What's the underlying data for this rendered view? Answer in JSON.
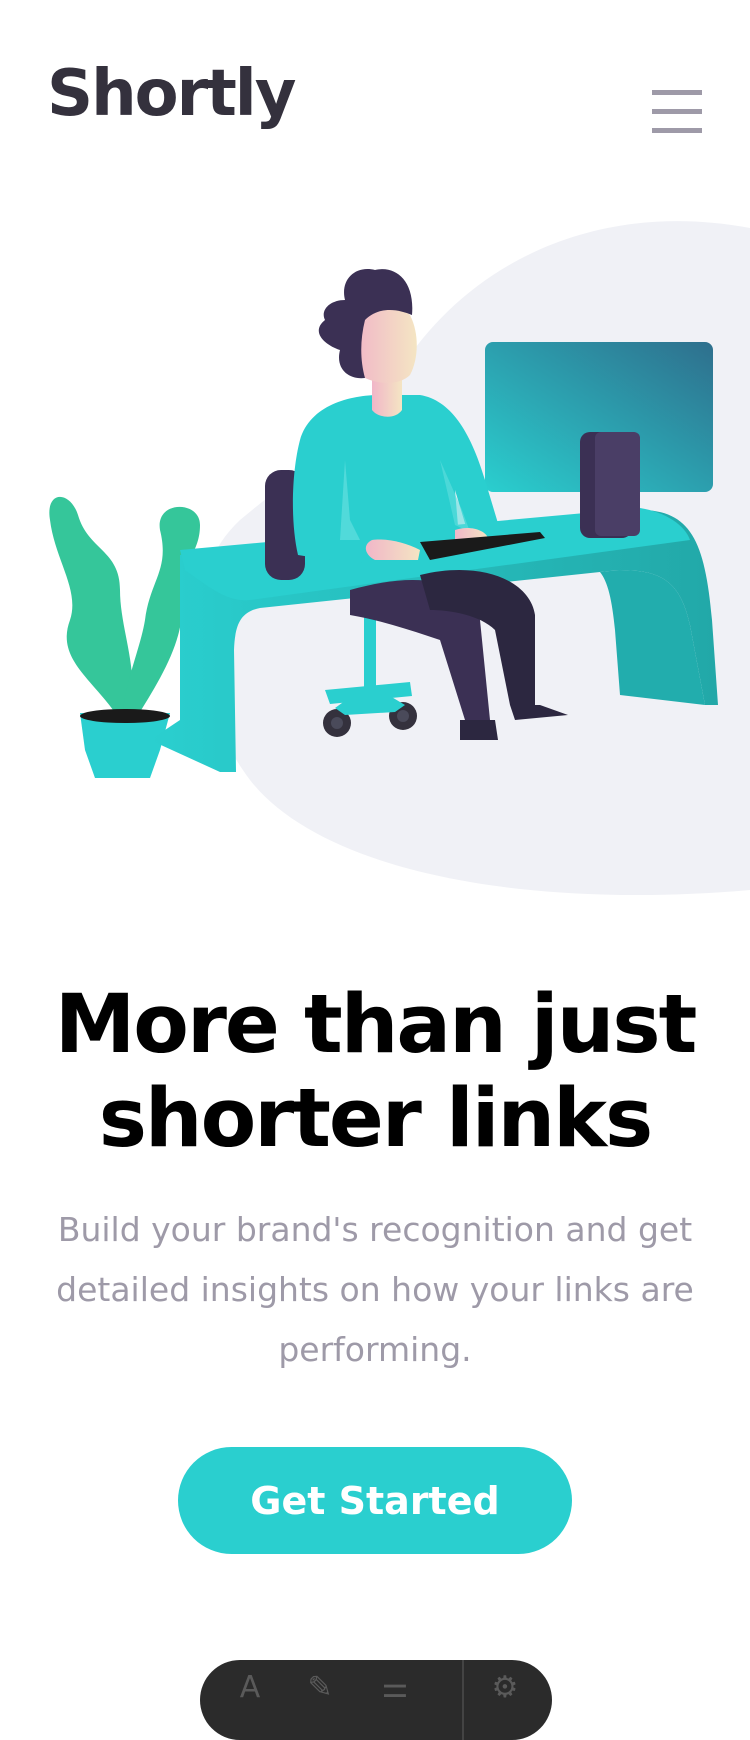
{
  "header": {
    "logo_text": "Shortly",
    "menu_icon": "hamburger-menu-icon"
  },
  "hero": {
    "illustration": "person-working-at-desk-illustration",
    "headline_line1": "More than just",
    "headline_line2": "shorter links",
    "description": "Build your brand's recognition and get detailed insights on how your links are performing.",
    "cta_label": "Get Started"
  },
  "floating_toolbar": {
    "icons": [
      "text-tool-icon",
      "brush-icon",
      "adjust-icon",
      "settings-icon"
    ]
  },
  "colors": {
    "primary": "#2acfcf",
    "dark_violet": "#3b3054",
    "grayish_violet": "#9e9aa8",
    "very_dark_blue": "#34313d",
    "blob_background": "#f0f1f6",
    "plant_green": "#35c69a"
  }
}
